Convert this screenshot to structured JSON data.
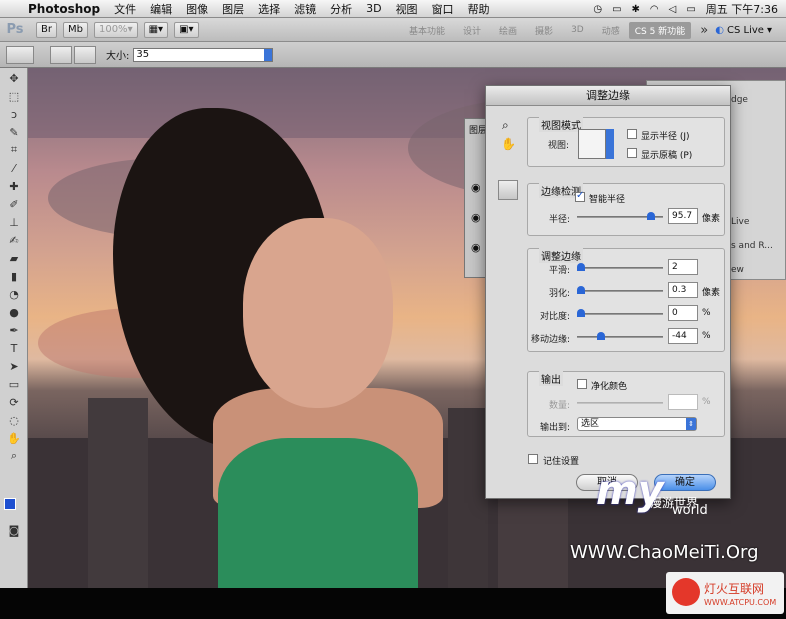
{
  "menubar": {
    "app": "Photoshop",
    "items": [
      "文件",
      "编辑",
      "图像",
      "图层",
      "选择",
      "滤镜",
      "分析",
      "3D",
      "视图",
      "窗口",
      "帮助"
    ],
    "clock": "周五 下午7:36"
  },
  "appbar": {
    "ps": "Ps",
    "zoom": "100%",
    "workspaces": [
      "基本功能",
      "设计",
      "绘画",
      "摄影",
      "3D",
      "动感"
    ],
    "active_workspace": "CS 5 新功能",
    "more": "»",
    "cslive": "CS Live"
  },
  "options": {
    "size_label": "大小:",
    "size_value": "35"
  },
  "rightpanel": {
    "lines": [
      "dge",
      "Live",
      "s and R...",
      "ew"
    ]
  },
  "layers": {
    "title": "图层"
  },
  "dialog": {
    "title": "调整边缘",
    "view_mode": {
      "title": "视图模式",
      "view_label": "视图:",
      "show_radius": "显示半径 (J)",
      "show_original": "显示原稿 (P)"
    },
    "edge_detection": {
      "title": "边缘检测",
      "smart_radius": "智能半径",
      "radius_label": "半径:",
      "radius_value": "95.7",
      "radius_unit": "像素"
    },
    "adjust_edge": {
      "title": "调整边缘",
      "smooth_label": "平滑:",
      "smooth_value": "2",
      "feather_label": "羽化:",
      "feather_value": "0.3",
      "feather_unit": "像素",
      "contrast_label": "对比度:",
      "contrast_value": "0",
      "contrast_unit": "%",
      "shift_label": "移动边缘:",
      "shift_value": "-44",
      "shift_unit": "%"
    },
    "output": {
      "title": "输出",
      "decontaminate": "净化颜色",
      "amount_label": "数量:",
      "amount_unit": "%",
      "output_to_label": "输出到:",
      "output_to_value": "选区"
    },
    "remember": "记住设置",
    "cancel": "取消",
    "ok": "确定"
  },
  "watermark": {
    "my": "my",
    "world": "world",
    "cn": "漫游世界",
    "url": "WWW.ChaoMeiTi.Org",
    "site_cn": "灯火互联网",
    "site_url": "WWW.ATCPU.COM"
  }
}
